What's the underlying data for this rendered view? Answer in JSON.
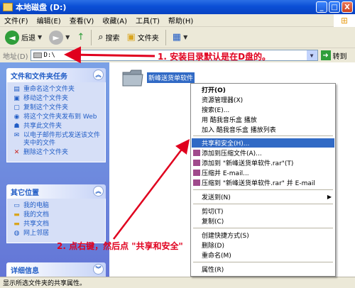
{
  "window": {
    "title": "本地磁盘 (D:)",
    "minimize": "_",
    "maximize": "□",
    "close": "X"
  },
  "menubar": [
    "文件(F)",
    "编辑(E)",
    "查看(V)",
    "收藏(A)",
    "工具(T)",
    "帮助(H)"
  ],
  "toolbar": {
    "back": "后退",
    "search": "搜索",
    "folders": "文件夹"
  },
  "address": {
    "label": "地址(D)",
    "value": "D:\\",
    "go": "转到"
  },
  "tasks_panel": {
    "title": "文件和文件夹任务",
    "items": [
      "重命名这个文件夹",
      "移动这个文件夹",
      "复制这个文件夹",
      "将这个文件夹发布到 Web",
      "共享此文件夹",
      "以电子邮件形式发送该文件夹中的文件",
      "删除这个文件夹"
    ]
  },
  "places_panel": {
    "title": "其它位置",
    "items": [
      "我的电脑",
      "我的文档",
      "共享文档",
      "网上邻居"
    ]
  },
  "details_panel": {
    "title": "详细信息"
  },
  "folder": {
    "name": "新峰送货单软件"
  },
  "context_menu": {
    "open": "打开(O)",
    "explorer": "资源管理器(X)",
    "search": "搜索(E)...",
    "kugou_play": "用 酷我音乐盒 播放",
    "kugou_add": "加入 酷我音乐盒 播放列表",
    "share": "共享和安全(H)...",
    "add_archive": "添加到压缩文件(A)...",
    "add_rar": "添加到 \"新峰送货单软件.rar\"(T)",
    "compress_email": "压缩并 E-mail...",
    "compress_rar_email": "压缩到 \"新峰送货单软件.rar\" 并 E-mail",
    "send_to": "发送到(N)",
    "cut": "剪切(T)",
    "copy": "复制(C)",
    "create_shortcut": "创建快捷方式(S)",
    "delete": "删除(D)",
    "rename": "重命名(M)",
    "properties": "属性(R)"
  },
  "annotations": {
    "note1": "1. 安装目录默认是在D盘的。",
    "note2": "2. 点右键，然后点 \"共享和安全\""
  },
  "status": "显示所选文件夹的共享属性。",
  "colors": {
    "title_blue": "#0a4fd6",
    "highlight": "#316ac5",
    "annotation_red": "#e0001e",
    "pane_blue": "#6375d6"
  }
}
